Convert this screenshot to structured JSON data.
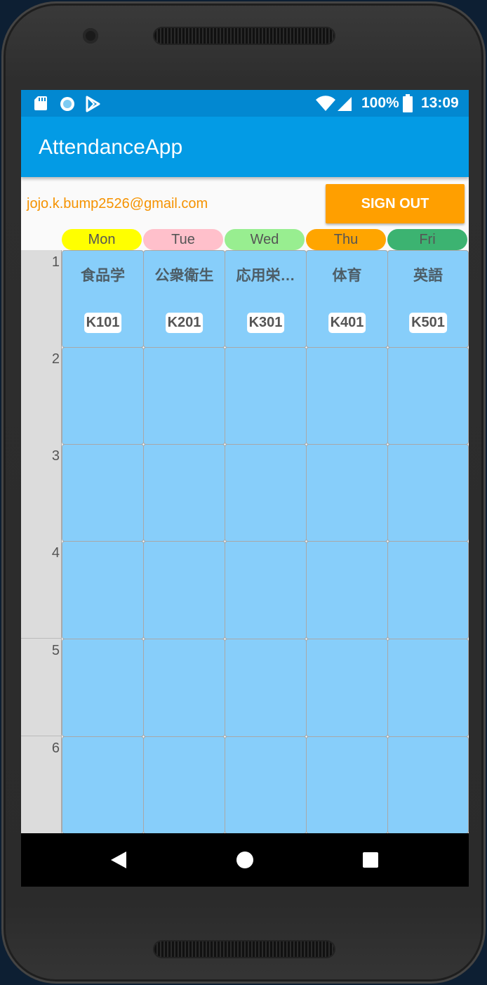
{
  "status_bar": {
    "icons_left": [
      "sd-card-icon",
      "circle-notification-icon",
      "play-store-icon"
    ],
    "battery": "100%",
    "time": "13:09"
  },
  "app_bar": {
    "title": "AttendanceApp"
  },
  "account": {
    "email": "jojo.k.bump2526@gmail.com",
    "sign_out_label": "SIGN OUT"
  },
  "days": [
    {
      "label": "Mon",
      "color": "#ffff00"
    },
    {
      "label": "Tue",
      "color": "#ffc0cb"
    },
    {
      "label": "Wed",
      "color": "#98ee90"
    },
    {
      "label": "Thu",
      "color": "#ffa500"
    },
    {
      "label": "Fri",
      "color": "#3cb371"
    }
  ],
  "periods": [
    "1",
    "2",
    "3",
    "4",
    "5",
    "6"
  ],
  "timetable": {
    "row1": [
      {
        "subject": "食品学",
        "room": "K101"
      },
      {
        "subject": "公衆衛生",
        "room": "K201"
      },
      {
        "subject": "応用栄…",
        "room": "K301"
      },
      {
        "subject": "体育",
        "room": "K401"
      },
      {
        "subject": "英語",
        "room": "K501"
      }
    ]
  },
  "colors": {
    "cell": "#87cefa",
    "status_bar": "#0288d1",
    "app_bar": "#039be5",
    "accent": "#ff9f00"
  }
}
